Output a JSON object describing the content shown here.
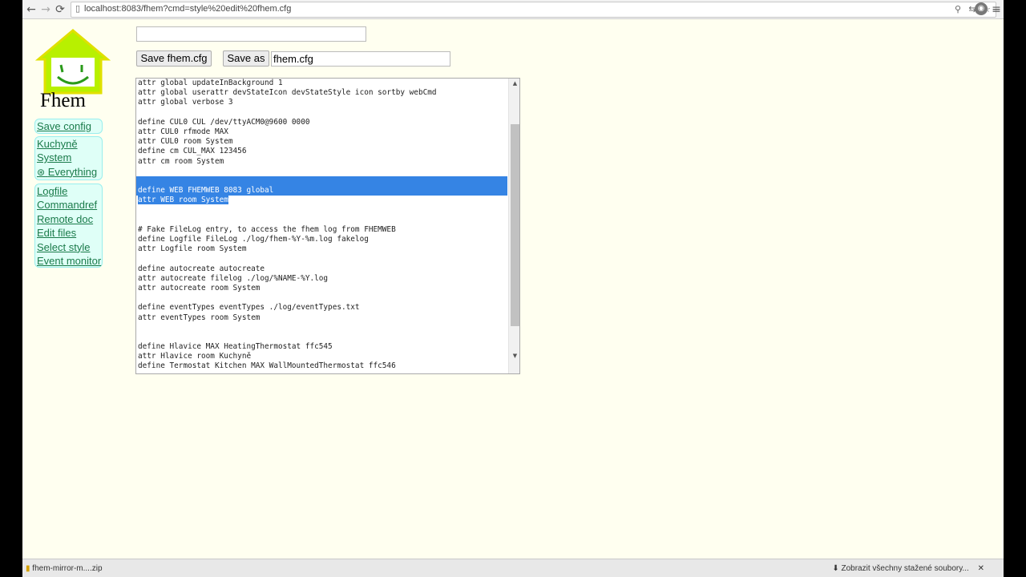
{
  "browser": {
    "url": "localhost:8083/fhem?cmd=style%20edit%20fhem.cfg",
    "icons": [
      "back-arrow-icon",
      "forward-arrow-icon",
      "reload-icon",
      "zoom-icon",
      "translate-icon",
      "star-icon",
      "chrome-icon",
      "menu-icon"
    ]
  },
  "logo": {
    "text": "Fhem"
  },
  "menu": {
    "block1": [
      "Save config"
    ],
    "block2": [
      "Kuchyně",
      "System",
      "Everything"
    ],
    "block3": [
      "Logfile",
      "Commandref",
      "Remote doc",
      "Edit files",
      "Select style",
      "Event monitor"
    ]
  },
  "editor": {
    "top_input_value": "",
    "save_button": "Save fhem.cfg",
    "save_as_button": "Save as",
    "save_as_value": "fhem.cfg",
    "lines": [
      "attr global updateInBackground 1",
      "attr global userattr devStateIcon devStateStyle icon sortby webCmd",
      "attr global verbose 3",
      "",
      "define CUL0 CUL /dev/ttyACM0@9600 0000",
      "attr CUL0 rfmode MAX",
      "attr CUL0 room System",
      "define cm CUL_MAX 123456",
      "attr cm room System",
      "",
      "",
      "define WEB FHEMWEB 8083 global",
      "attr WEB room System",
      "",
      "",
      "# Fake FileLog entry, to access the fhem log from FHEMWEB",
      "define Logfile FileLog ./log/fhem-%Y-%m.log fakelog",
      "attr Logfile room System",
      "",
      "define autocreate autocreate",
      "attr autocreate filelog ./log/%NAME-%Y.log",
      "attr autocreate room System",
      "",
      "define eventTypes eventTypes ./log/eventTypes.txt",
      "attr eventTypes room System",
      "",
      "",
      "define Hlavice MAX HeatingThermostat ffc545",
      "attr Hlavice room Kuchyně",
      "define Termostat Kitchen MAX WallMountedThermostat ffc546"
    ],
    "selected_lines": [
      10,
      11
    ],
    "partial_selected_line": 12
  },
  "downloads": {
    "item": "fhem-mirror-m....zip",
    "show_all": "Zobrazit všechny stažené soubory..."
  }
}
